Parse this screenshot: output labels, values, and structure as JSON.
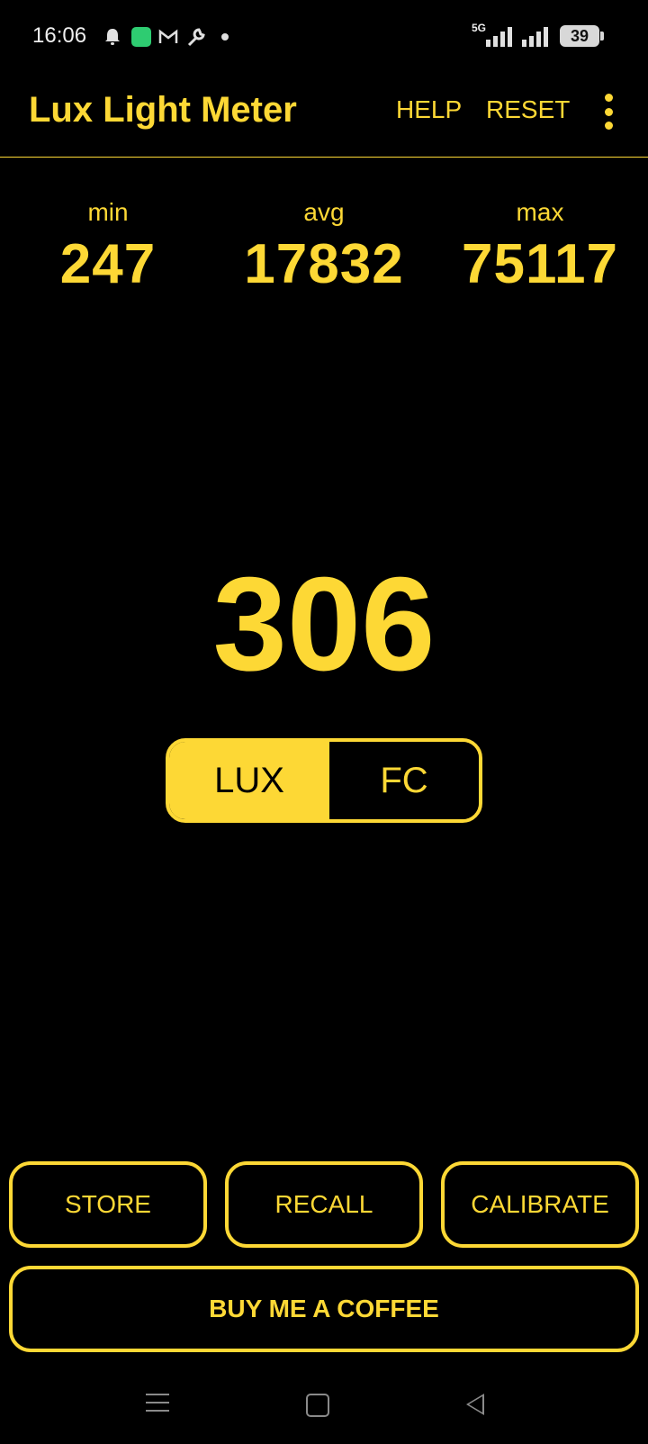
{
  "status_bar": {
    "time": "16:06",
    "network": "5G",
    "battery": "39",
    "icons": [
      "bell-icon",
      "battery-saver-icon",
      "gmail-icon",
      "wrench-icon",
      "dot-icon"
    ]
  },
  "app_bar": {
    "title": "Lux Light Meter",
    "help_label": "HELP",
    "reset_label": "RESET"
  },
  "stats": {
    "min_label": "min",
    "min_value": "247",
    "avg_label": "avg",
    "avg_value": "17832",
    "max_label": "max",
    "max_value": "75117"
  },
  "reading": "306",
  "unit_toggle": {
    "options": [
      "LUX",
      "FC"
    ],
    "selected": "LUX"
  },
  "actions": {
    "store_label": "STORE",
    "recall_label": "RECALL",
    "calibrate_label": "CALIBRATE",
    "coffee_label": "BUY ME A COFFEE"
  },
  "colors": {
    "accent": "#FDD835",
    "background": "#000000"
  }
}
